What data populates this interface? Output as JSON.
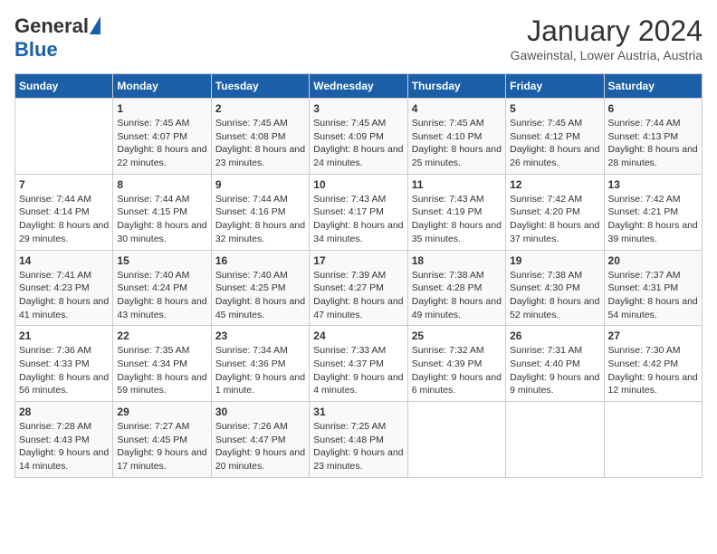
{
  "header": {
    "logo_general": "General",
    "logo_blue": "Blue",
    "title": "January 2024",
    "subtitle": "Gaweinstal, Lower Austria, Austria"
  },
  "days_of_week": [
    "Sunday",
    "Monday",
    "Tuesday",
    "Wednesday",
    "Thursday",
    "Friday",
    "Saturday"
  ],
  "weeks": [
    [
      {
        "day": "",
        "sunrise": "",
        "sunset": "",
        "daylight": ""
      },
      {
        "day": "1",
        "sunrise": "Sunrise: 7:45 AM",
        "sunset": "Sunset: 4:07 PM",
        "daylight": "Daylight: 8 hours and 22 minutes."
      },
      {
        "day": "2",
        "sunrise": "Sunrise: 7:45 AM",
        "sunset": "Sunset: 4:08 PM",
        "daylight": "Daylight: 8 hours and 23 minutes."
      },
      {
        "day": "3",
        "sunrise": "Sunrise: 7:45 AM",
        "sunset": "Sunset: 4:09 PM",
        "daylight": "Daylight: 8 hours and 24 minutes."
      },
      {
        "day": "4",
        "sunrise": "Sunrise: 7:45 AM",
        "sunset": "Sunset: 4:10 PM",
        "daylight": "Daylight: 8 hours and 25 minutes."
      },
      {
        "day": "5",
        "sunrise": "Sunrise: 7:45 AM",
        "sunset": "Sunset: 4:12 PM",
        "daylight": "Daylight: 8 hours and 26 minutes."
      },
      {
        "day": "6",
        "sunrise": "Sunrise: 7:44 AM",
        "sunset": "Sunset: 4:13 PM",
        "daylight": "Daylight: 8 hours and 28 minutes."
      }
    ],
    [
      {
        "day": "7",
        "sunrise": "Sunrise: 7:44 AM",
        "sunset": "Sunset: 4:14 PM",
        "daylight": "Daylight: 8 hours and 29 minutes."
      },
      {
        "day": "8",
        "sunrise": "Sunrise: 7:44 AM",
        "sunset": "Sunset: 4:15 PM",
        "daylight": "Daylight: 8 hours and 30 minutes."
      },
      {
        "day": "9",
        "sunrise": "Sunrise: 7:44 AM",
        "sunset": "Sunset: 4:16 PM",
        "daylight": "Daylight: 8 hours and 32 minutes."
      },
      {
        "day": "10",
        "sunrise": "Sunrise: 7:43 AM",
        "sunset": "Sunset: 4:17 PM",
        "daylight": "Daylight: 8 hours and 34 minutes."
      },
      {
        "day": "11",
        "sunrise": "Sunrise: 7:43 AM",
        "sunset": "Sunset: 4:19 PM",
        "daylight": "Daylight: 8 hours and 35 minutes."
      },
      {
        "day": "12",
        "sunrise": "Sunrise: 7:42 AM",
        "sunset": "Sunset: 4:20 PM",
        "daylight": "Daylight: 8 hours and 37 minutes."
      },
      {
        "day": "13",
        "sunrise": "Sunrise: 7:42 AM",
        "sunset": "Sunset: 4:21 PM",
        "daylight": "Daylight: 8 hours and 39 minutes."
      }
    ],
    [
      {
        "day": "14",
        "sunrise": "Sunrise: 7:41 AM",
        "sunset": "Sunset: 4:23 PM",
        "daylight": "Daylight: 8 hours and 41 minutes."
      },
      {
        "day": "15",
        "sunrise": "Sunrise: 7:40 AM",
        "sunset": "Sunset: 4:24 PM",
        "daylight": "Daylight: 8 hours and 43 minutes."
      },
      {
        "day": "16",
        "sunrise": "Sunrise: 7:40 AM",
        "sunset": "Sunset: 4:25 PM",
        "daylight": "Daylight: 8 hours and 45 minutes."
      },
      {
        "day": "17",
        "sunrise": "Sunrise: 7:39 AM",
        "sunset": "Sunset: 4:27 PM",
        "daylight": "Daylight: 8 hours and 47 minutes."
      },
      {
        "day": "18",
        "sunrise": "Sunrise: 7:38 AM",
        "sunset": "Sunset: 4:28 PM",
        "daylight": "Daylight: 8 hours and 49 minutes."
      },
      {
        "day": "19",
        "sunrise": "Sunrise: 7:38 AM",
        "sunset": "Sunset: 4:30 PM",
        "daylight": "Daylight: 8 hours and 52 minutes."
      },
      {
        "day": "20",
        "sunrise": "Sunrise: 7:37 AM",
        "sunset": "Sunset: 4:31 PM",
        "daylight": "Daylight: 8 hours and 54 minutes."
      }
    ],
    [
      {
        "day": "21",
        "sunrise": "Sunrise: 7:36 AM",
        "sunset": "Sunset: 4:33 PM",
        "daylight": "Daylight: 8 hours and 56 minutes."
      },
      {
        "day": "22",
        "sunrise": "Sunrise: 7:35 AM",
        "sunset": "Sunset: 4:34 PM",
        "daylight": "Daylight: 8 hours and 59 minutes."
      },
      {
        "day": "23",
        "sunrise": "Sunrise: 7:34 AM",
        "sunset": "Sunset: 4:36 PM",
        "daylight": "Daylight: 9 hours and 1 minute."
      },
      {
        "day": "24",
        "sunrise": "Sunrise: 7:33 AM",
        "sunset": "Sunset: 4:37 PM",
        "daylight": "Daylight: 9 hours and 4 minutes."
      },
      {
        "day": "25",
        "sunrise": "Sunrise: 7:32 AM",
        "sunset": "Sunset: 4:39 PM",
        "daylight": "Daylight: 9 hours and 6 minutes."
      },
      {
        "day": "26",
        "sunrise": "Sunrise: 7:31 AM",
        "sunset": "Sunset: 4:40 PM",
        "daylight": "Daylight: 9 hours and 9 minutes."
      },
      {
        "day": "27",
        "sunrise": "Sunrise: 7:30 AM",
        "sunset": "Sunset: 4:42 PM",
        "daylight": "Daylight: 9 hours and 12 minutes."
      }
    ],
    [
      {
        "day": "28",
        "sunrise": "Sunrise: 7:28 AM",
        "sunset": "Sunset: 4:43 PM",
        "daylight": "Daylight: 9 hours and 14 minutes."
      },
      {
        "day": "29",
        "sunrise": "Sunrise: 7:27 AM",
        "sunset": "Sunset: 4:45 PM",
        "daylight": "Daylight: 9 hours and 17 minutes."
      },
      {
        "day": "30",
        "sunrise": "Sunrise: 7:26 AM",
        "sunset": "Sunset: 4:47 PM",
        "daylight": "Daylight: 9 hours and 20 minutes."
      },
      {
        "day": "31",
        "sunrise": "Sunrise: 7:25 AM",
        "sunset": "Sunset: 4:48 PM",
        "daylight": "Daylight: 9 hours and 23 minutes."
      },
      {
        "day": "",
        "sunrise": "",
        "sunset": "",
        "daylight": ""
      },
      {
        "day": "",
        "sunrise": "",
        "sunset": "",
        "daylight": ""
      },
      {
        "day": "",
        "sunrise": "",
        "sunset": "",
        "daylight": ""
      }
    ]
  ]
}
